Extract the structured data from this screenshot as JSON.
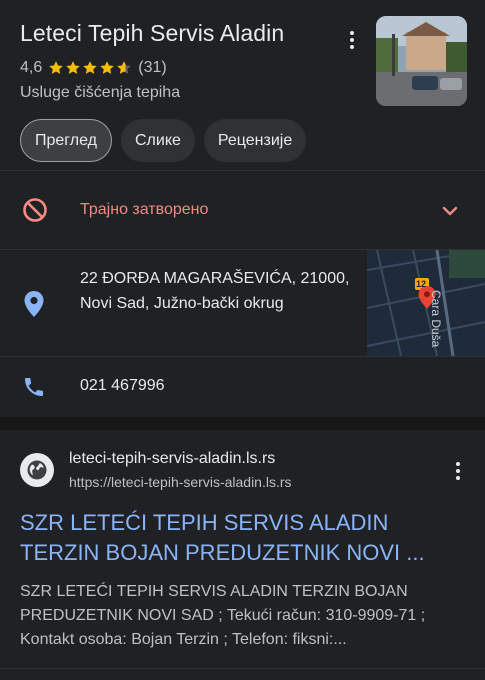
{
  "place": {
    "title": "Leteci Tepih Servis Aladin",
    "rating": "4,6",
    "stars": 4.6,
    "reviews": "(31)",
    "category": "Usluge čišćenja tepiha"
  },
  "tabs": [
    {
      "label": "Преглед",
      "active": true
    },
    {
      "label": "Слике",
      "active": false
    },
    {
      "label": "Рецензије",
      "active": false
    }
  ],
  "status": {
    "text": "Трајно затворено",
    "color": "#f28b82"
  },
  "address": {
    "text": "22 ĐORĐA MAGARAŠEVIĆA, 21000, Novi Sad, Južno-bački okrug",
    "map_street_label": "Cara Duša",
    "map_badge": "12"
  },
  "phone": {
    "text": "021 467996"
  },
  "web_result": {
    "site_name": "leteci-tepih-servis-aladin.ls.rs",
    "url": "https://leteci-tepih-servis-aladin.ls.rs",
    "title": "SZR LETEĆI TEPIH SERVIS ALADIN TERZIN BOJAN PREDUZETNIK NOVI ...",
    "snippet": "SZR LETEĆI TEPIH SERVIS ALADIN TERZIN BOJAN PREDUZETNIK NOVI SAD ; Tekući račun: 310-9909-71 ; Kontakt osoba: Bojan Terzin ; Telefon: fiksni:..."
  },
  "colors": {
    "background": "#202124",
    "link": "#8ab4f8",
    "star": "#fbbc04",
    "icon_blue": "#8ab4f8",
    "closed_red": "#f28b82"
  },
  "icons": {
    "menu": "more-vert-icon",
    "status": "block-icon",
    "expand": "chevron-down-icon",
    "address": "location-pin-icon",
    "phone": "phone-icon",
    "site": "globe-icon"
  }
}
